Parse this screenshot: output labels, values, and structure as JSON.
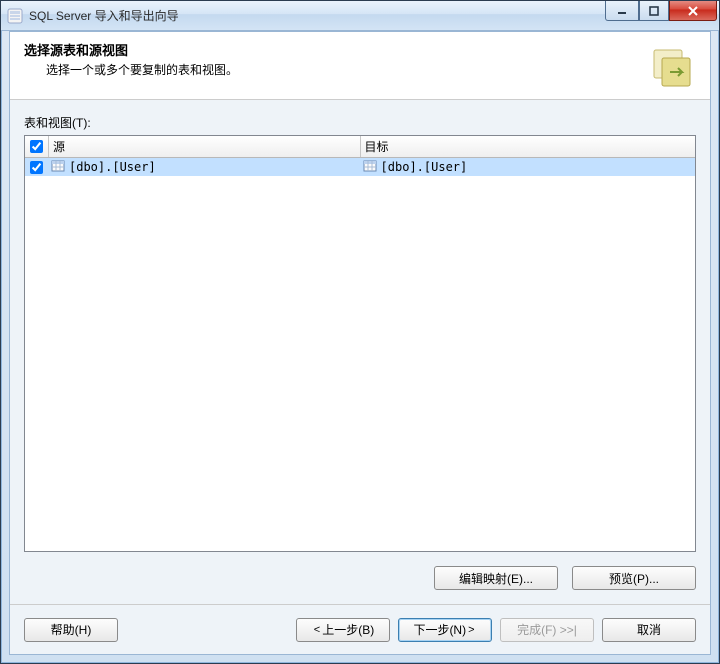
{
  "window": {
    "title": "SQL Server 导入和导出向导"
  },
  "header": {
    "title": "选择源表和源视图",
    "subtitle": "选择一个或多个要复制的表和视图。"
  },
  "body": {
    "tables_label": "表和视图(T):",
    "columns": {
      "source": "源",
      "target": "目标"
    },
    "rows": [
      {
        "checked": true,
        "source": "[dbo].[User]",
        "target": "[dbo].[User]",
        "selected": true
      }
    ]
  },
  "action_buttons": {
    "edit_mapping": "编辑映射(E)...",
    "preview": "预览(P)..."
  },
  "footer": {
    "help": "帮助(H)",
    "back": "上一步(B)",
    "next": "下一步(N)",
    "finish": "完成(F) >>|",
    "cancel": "取消"
  }
}
